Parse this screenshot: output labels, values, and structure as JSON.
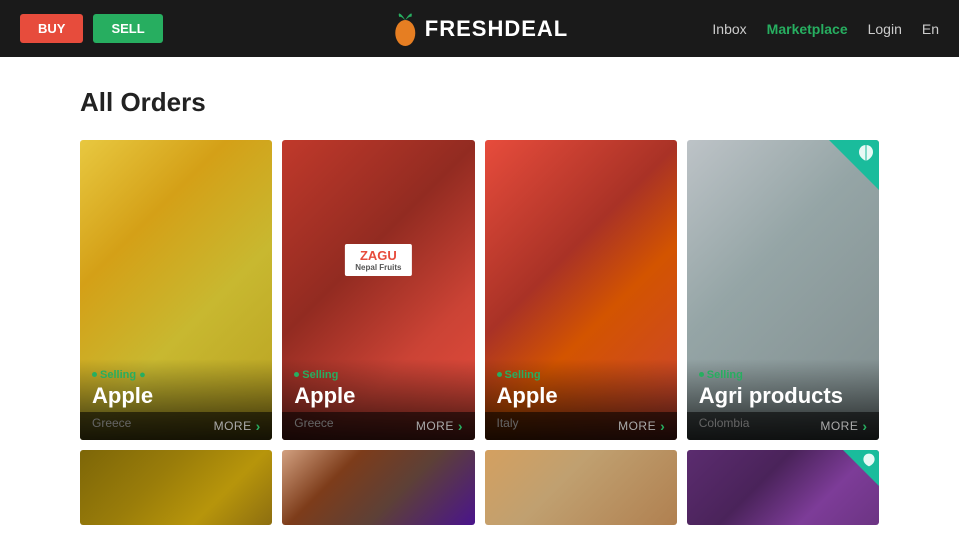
{
  "header": {
    "buy_label": "BUY",
    "sell_label": "SELL",
    "logo_text": "FRESHDEAL",
    "nav": {
      "inbox": "Inbox",
      "marketplace": "Marketplace",
      "login": "Login",
      "language": "En"
    }
  },
  "page": {
    "title": "All Orders"
  },
  "cards": [
    {
      "id": 1,
      "selling_label": "Selling",
      "product_name": "Apple",
      "location": "Greece",
      "more_label": "MORE",
      "img_class": "img-yellow-apples",
      "organic": false
    },
    {
      "id": 2,
      "selling_label": "Selling",
      "product_name": "Apple",
      "location": "Greece",
      "more_label": "MORE",
      "img_class": "img-red-apples",
      "organic": false
    },
    {
      "id": 3,
      "selling_label": "Selling",
      "product_name": "Apple",
      "location": "Italy",
      "more_label": "MORE",
      "img_class": "img-red-apples2",
      "organic": false
    },
    {
      "id": 4,
      "selling_label": "Selling",
      "product_name": "Agri products",
      "location": "Colombia",
      "more_label": "MORE",
      "img_class": "img-agri",
      "organic": true
    }
  ],
  "cards_row2": [
    {
      "id": 5,
      "img_class": "img-brown-nuts",
      "organic": false
    },
    {
      "id": 6,
      "img_class": "img-pink-apples",
      "organic": false
    },
    {
      "id": 7,
      "img_class": "img-mixed",
      "organic": false
    },
    {
      "id": 8,
      "img_class": "img-purple-bags",
      "organic": true
    }
  ],
  "icons": {
    "arrow_right": "›",
    "leaf": "🌿"
  }
}
